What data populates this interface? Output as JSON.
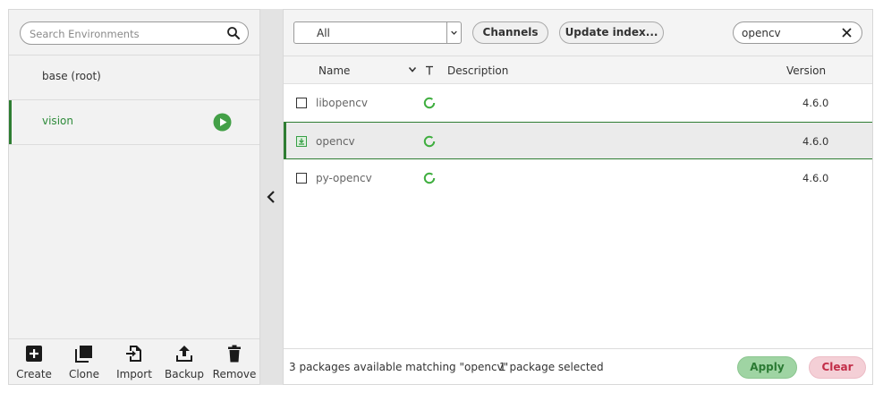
{
  "environments": {
    "search_placeholder": "Search Environments",
    "items": [
      {
        "label": "base (root)",
        "active": false
      },
      {
        "label": "vision",
        "active": true
      }
    ],
    "actions": [
      {
        "label": "Create",
        "icon": "plus-square-icon"
      },
      {
        "label": "Clone",
        "icon": "copy-icon"
      },
      {
        "label": "Import",
        "icon": "import-icon"
      },
      {
        "label": "Backup",
        "icon": "upload-icon"
      },
      {
        "label": "Remove",
        "icon": "trash-icon"
      }
    ]
  },
  "packages": {
    "filter_value": "All",
    "channels_label": "Channels",
    "update_index_label": "Update index...",
    "search_value": "opencv",
    "columns": {
      "name": "Name",
      "description": "Description",
      "version": "Version"
    },
    "rows": [
      {
        "name": "libopencv",
        "description": "",
        "version": "4.6.0",
        "installed": false,
        "selected": false
      },
      {
        "name": "opencv",
        "description": "",
        "version": "4.6.0",
        "installed": true,
        "selected": true
      },
      {
        "name": "py-opencv",
        "description": "",
        "version": "4.6.0",
        "installed": false,
        "selected": false
      }
    ],
    "status_text": "3 packages available matching \"opencv\"",
    "selection_text": "1 package selected",
    "apply_label": "Apply",
    "clear_label": "Clear"
  },
  "colors": {
    "accent_green": "#2e7d32",
    "apply_bg": "#9fd4a3",
    "clear_bg": "#f4cfd6"
  }
}
